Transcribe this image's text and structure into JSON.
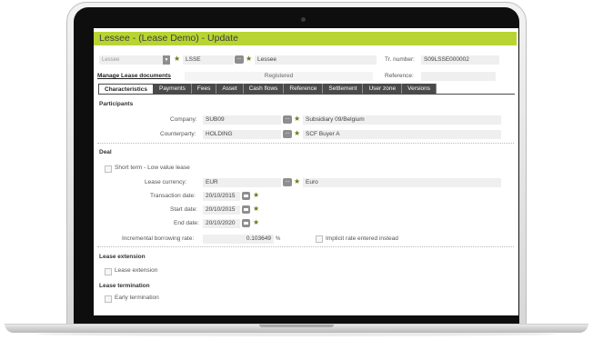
{
  "app": {
    "title": "Lessee - (Lease Demo) - Update",
    "accent_color": "#b8d432"
  },
  "header": {
    "type_select": "Lessee",
    "code": "LSSE",
    "code_desc": "Lessee",
    "tr_number_label": "Tr. number:",
    "tr_number": "S09LSSE000002",
    "manage_link": "Manage Lease documents",
    "status": "Registered",
    "reference_label": "Reference:",
    "reference": ""
  },
  "tabs": [
    "Characteristics",
    "Payments",
    "Fees",
    "Asset",
    "Cash flows",
    "Reference",
    "Settlement",
    "User zone",
    "Versions"
  ],
  "participants": {
    "heading": "Participants",
    "company_label": "Company:",
    "company": "SUB09",
    "company_desc": "Subsidiary 09/Belgium",
    "counterparty_label": "Counterparty:",
    "counterparty": "HOLDING",
    "counterparty_desc": "SCF Buyer A"
  },
  "deal": {
    "heading": "Deal",
    "short_term_label": "Short term - Low value lease",
    "currency_label": "Lease currency:",
    "currency": "EUR",
    "currency_desc": "Euro",
    "transaction_date_label": "Transaction date:",
    "transaction_date": "20/10/2015",
    "start_date_label": "Start date:",
    "start_date": "20/10/2015",
    "end_date_label": "End date:",
    "end_date": "20/10/2020",
    "ibr_label": "Incremental borrowing rate:",
    "ibr_value": "0.103649",
    "ibr_unit": "%",
    "implicit_label": "Implicit rate entered instead"
  },
  "extension": {
    "heading": "Lease extension",
    "checkbox_label": "Lease extension"
  },
  "termination": {
    "heading": "Lease termination",
    "checkbox_label": "Early termination"
  }
}
